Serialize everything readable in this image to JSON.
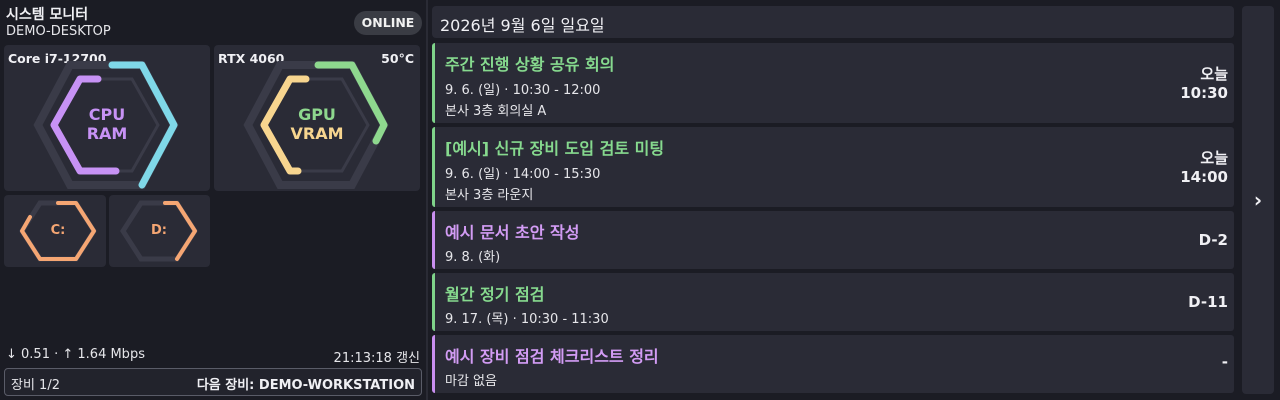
{
  "header": {
    "title": "시스템 모니터",
    "host": "DEMO-DESKTOP",
    "status": "ONLINE"
  },
  "cpu_card": {
    "name": "Core i7-12700",
    "line1": "CPU",
    "line2": "RAM"
  },
  "gpu_card": {
    "name": "RTX 4060",
    "temp": "50°C",
    "line1": "GPU",
    "line2": "VRAM"
  },
  "disks": [
    {
      "label": "C:"
    },
    {
      "label": "D:"
    }
  ],
  "footer": {
    "network": "↓ 0.51 · ↑ 1.64 Mbps",
    "updated": "21:13:18 갱신",
    "device_index": "장비 1/2",
    "next_device": "다음 장비: DEMO-WORKSTATION"
  },
  "calendar": {
    "date_header": "2026년 9월 6일 일요일",
    "next_icon": "chevron-right-icon",
    "next_glyph": "›",
    "events": [
      {
        "title": "주간 진행 상황 공유 회의",
        "time": "9. 6. (일) · 10:30 - 12:00",
        "location": "본사 3층 회의실 A",
        "right_top": "오늘",
        "right_bottom": "10:30",
        "color": "#7fd38a"
      },
      {
        "title": "[예시] 신규 장비 도입 검토 미팅",
        "time": "9. 6. (일) · 14:00 - 15:30",
        "location": "본사 3층 라운지",
        "right_top": "오늘",
        "right_bottom": "14:00",
        "color": "#7fd38a"
      },
      {
        "title": "예시 문서 초안 작성",
        "time": "9. 8. (화)",
        "location": "",
        "right_top": "",
        "right_bottom": "D-2",
        "color": "#c98ff0"
      },
      {
        "title": "월간 정기 점검",
        "time": "9. 17. (목) · 10:30 - 11:30",
        "location": "",
        "right_top": "",
        "right_bottom": "D-11",
        "color": "#7fd38a"
      },
      {
        "title": "예시 장비 점검 체크리스트 정리",
        "time": "마감 없음",
        "location": "",
        "right_top": "",
        "right_bottom": "-",
        "color": "#c98ff0"
      }
    ]
  },
  "colors": {
    "cpu": "#c792f5",
    "ram": "#7fd8e8",
    "gpu": "#8ed88e",
    "vram": "#f7d58f",
    "disk": "#f5a673"
  }
}
